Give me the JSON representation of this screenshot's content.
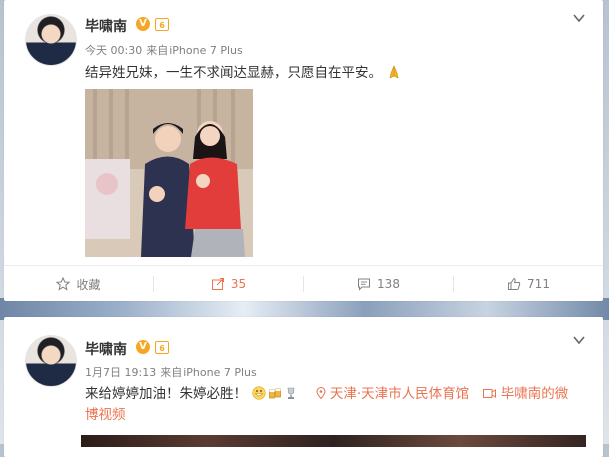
{
  "posts": [
    {
      "username": "毕啸南",
      "verified_badge": "V",
      "level_badge": "6",
      "time": "今天 00:30",
      "source_prefix": "来自",
      "source": "iPhone 7 Plus",
      "text": "结异姓兄妹，一生不求闻达显赫，只愿自在平安。",
      "emoji": "pray-emoji",
      "has_photo": true,
      "actions": {
        "favorite_label": "收藏",
        "repost_count": "35",
        "comment_count": "138",
        "like_count": "711"
      }
    },
    {
      "username": "毕啸南",
      "verified_badge": "V",
      "level_badge": "6",
      "time": "1月7日 19:13",
      "source_prefix": "来自",
      "source": "iPhone 7 Plus",
      "text_main": "来给婷婷加油！朱婷必胜！",
      "location": "天津·天津市人民体育馆",
      "video_link_line1": "毕啸南的微",
      "video_link_line2": "博视频"
    }
  ],
  "colors": {
    "accent": "#eb7350",
    "badge_orange": "#f6a623",
    "meta_gray": "#808080"
  }
}
